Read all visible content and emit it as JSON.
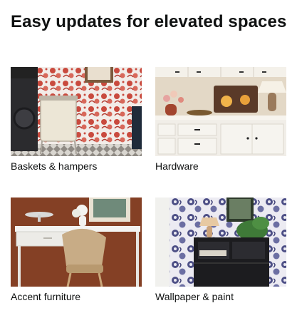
{
  "card": {
    "title": "Easy updates for elevated spaces",
    "tiles": [
      {
        "label": "Baskets & hampers",
        "image": "laundry-room-photo"
      },
      {
        "label": "Hardware",
        "image": "kitchen-cabinets-photo"
      },
      {
        "label": "Accent furniture",
        "image": "desk-and-chair-photo"
      },
      {
        "label": "Wallpaper & paint",
        "image": "floral-wallpaper-photo"
      }
    ]
  }
}
